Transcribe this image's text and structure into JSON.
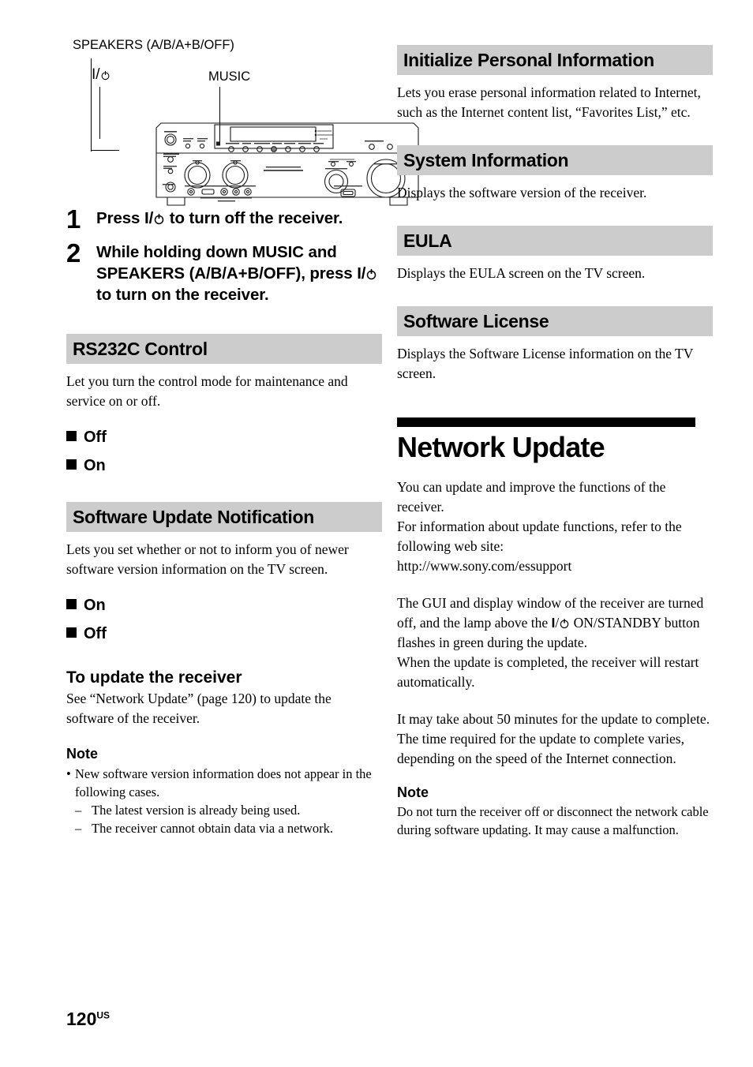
{
  "page": {
    "number": "120",
    "region_suffix": "US"
  },
  "figure": {
    "callouts": [
      {
        "name": "speakers",
        "label": "SPEAKERS (A/B/A+B/OFF)"
      },
      {
        "name": "power",
        "label": "I/⏻"
      },
      {
        "name": "music",
        "label": "MUSIC"
      }
    ],
    "device": "av-receiver-front-panel"
  },
  "steps": [
    {
      "number": "1",
      "pre": "Press ",
      "post": " to turn off the receiver."
    },
    {
      "number": "2",
      "pre": "While holding down MUSIC and SPEAKERS (A/B/A+B/OFF), press ",
      "post": " to turn on the receiver."
    }
  ],
  "left_column": {
    "rs232c": {
      "title": "RS232C Control",
      "body": "Let you turn the control mode for maintenance and service on or off.",
      "options": [
        "Off",
        "On"
      ]
    },
    "software_update_notification": {
      "title": "Software Update Notification",
      "body": "Lets you set whether or not to inform you of newer software version information on the TV screen.",
      "options": [
        "On",
        "Off"
      ]
    },
    "to_update": {
      "title": "To update the receiver",
      "body": "See “Network Update” (page 120) to update the software of the receiver."
    },
    "note": {
      "title": "Note",
      "bullet": "New software version information does not appear in the following cases.",
      "sub_items": [
        "The latest version is already being used.",
        "The receiver cannot obtain data via a network."
      ]
    }
  },
  "right_column": {
    "initialize_personal_information": {
      "title": "Initialize Personal Information",
      "body": "Lets you erase personal information related to Internet, such as the Internet content list, “Favorites List,” etc."
    },
    "system_information": {
      "title": "System Information",
      "body": "Displays the software version of the receiver."
    },
    "eula": {
      "title": "EULA",
      "body": "Displays the EULA screen on the TV screen."
    },
    "software_license": {
      "title": "Software License",
      "body": "Displays the Software License information on the TV screen."
    },
    "network_update": {
      "title": "Network Update",
      "para1": "You can update and improve the functions of the receiver.",
      "para2": "For information about update functions, refer to the following web site:",
      "url": "http://www.sony.com/essupport",
      "para3_pre": "The GUI and display window of the receiver are turned off, and the lamp above the ",
      "para3_post": " ON/STANDBY button flashes in green during the update.",
      "para4": "When the update is completed, the receiver will restart automatically.",
      "para5": "It may take about 50 minutes for the update to complete. The time required for the update to complete varies, depending on the speed of the Internet connection.",
      "note": {
        "title": "Note",
        "body": "Do not turn the receiver off or disconnect the network cable during software updating. It may cause a malfunction."
      }
    }
  },
  "colors": {
    "section_bar": "#cccccc",
    "chapter_rule": "#000000",
    "text": "#000000",
    "page_background": "#ffffff"
  }
}
